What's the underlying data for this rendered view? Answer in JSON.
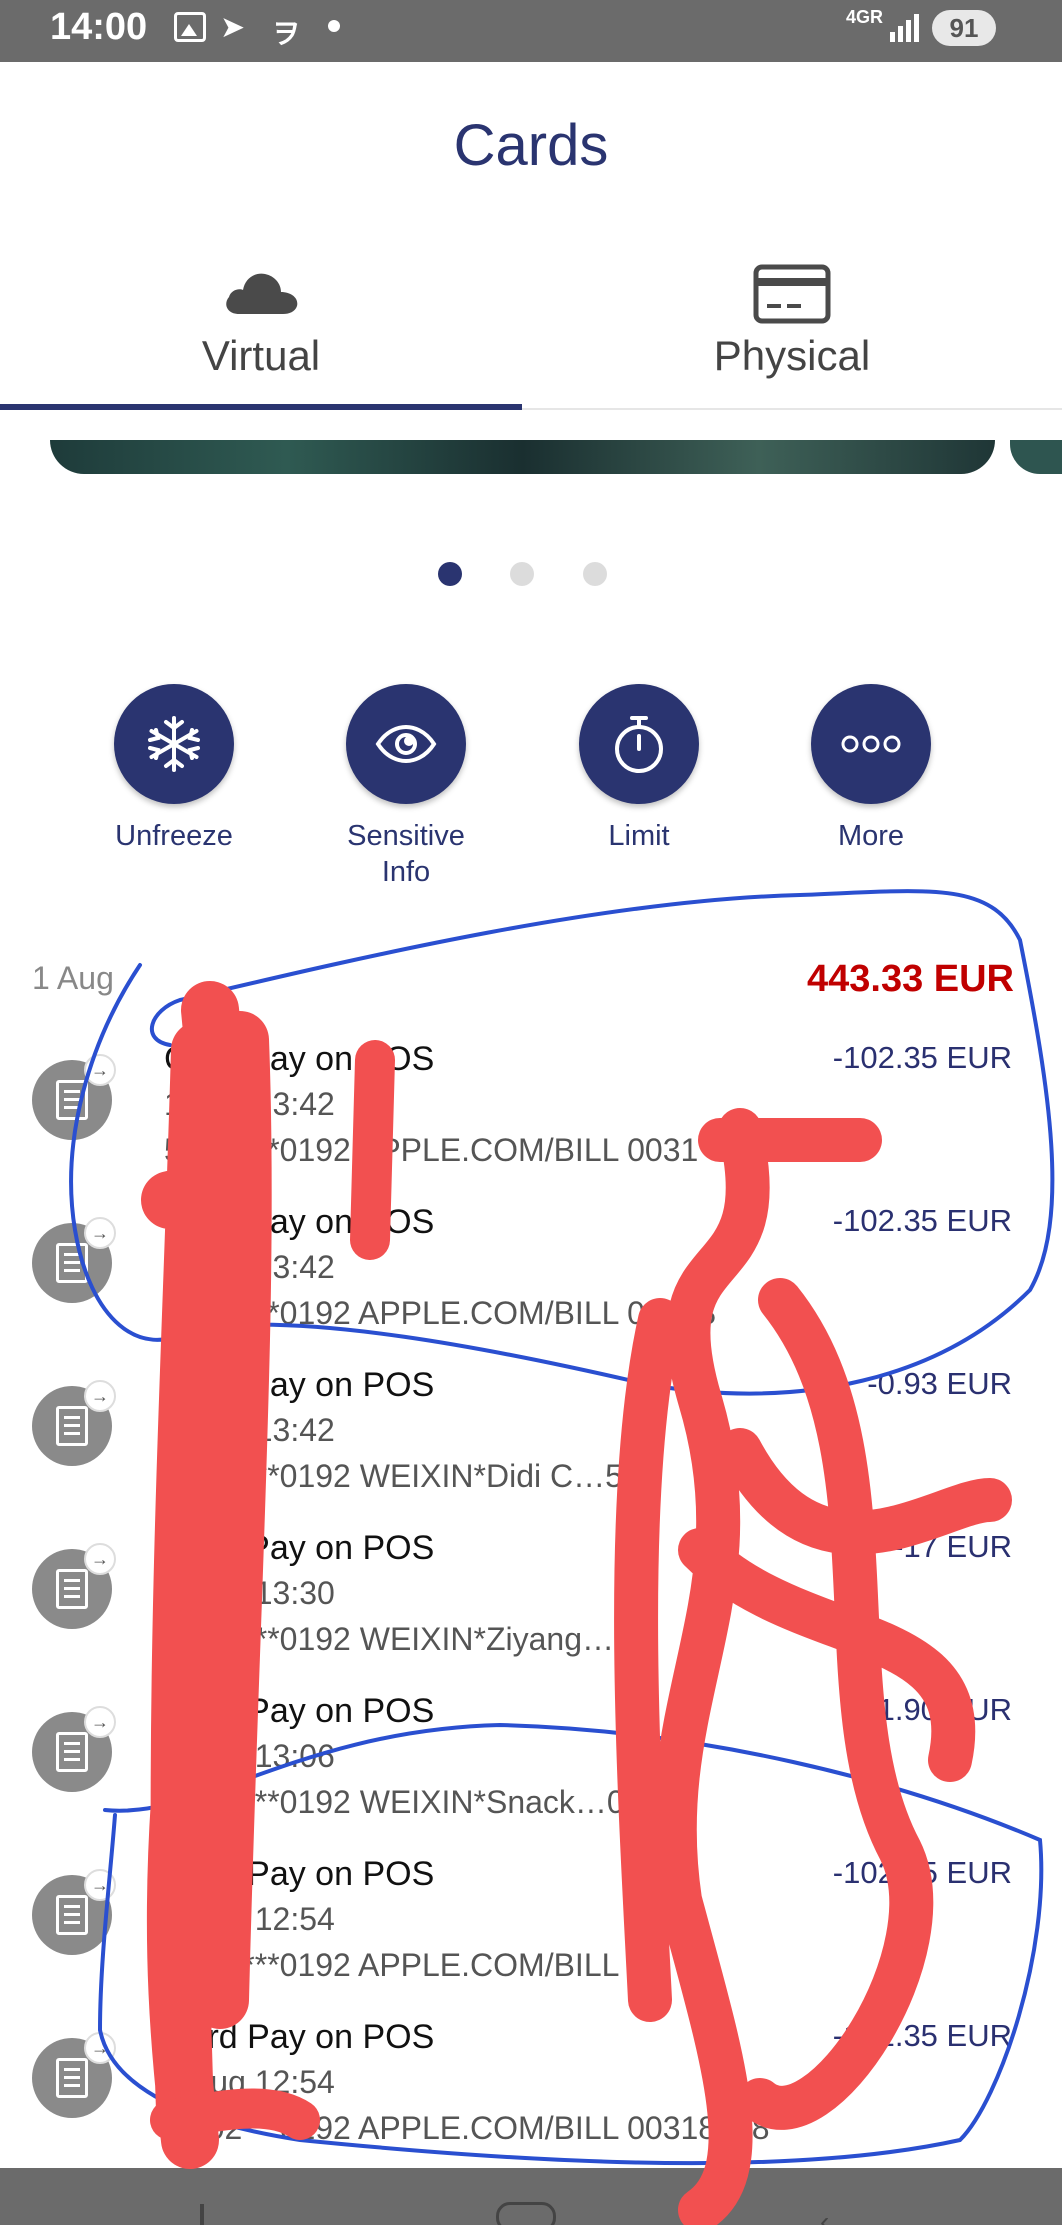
{
  "status_bar": {
    "time": "14:00",
    "network": "4G",
    "roaming": "R",
    "battery": "91"
  },
  "header": {
    "title": "Cards"
  },
  "tabs": [
    {
      "label": "Virtual",
      "icon": "cloud-icon",
      "active": true
    },
    {
      "label": "Physical",
      "icon": "card-icon",
      "active": false
    }
  ],
  "pager": {
    "count": 3,
    "active_index": 0
  },
  "actions": [
    {
      "label": "Unfreeze",
      "icon": "snowflake-icon"
    },
    {
      "label": "Sensitive Info",
      "icon": "eye-icon"
    },
    {
      "label": "Limit",
      "icon": "stopwatch-icon"
    },
    {
      "label": "More",
      "icon": "more-icon"
    }
  ],
  "transactions_group": {
    "date": "1 Aug",
    "total": "443.33 EUR",
    "total_color": "#c00000"
  },
  "transactions": [
    {
      "title": "Card Pay on POS",
      "time": "1 Aug 13:42",
      "description": "5**02***0192 APPLE.COM/BILL 0031",
      "amount": "-102.35 EUR"
    },
    {
      "title": "Card Pay on POS",
      "time": "1 Aug 13:42",
      "description": "5**02***0192 APPLE.COM/BILL 00318",
      "amount": "-102.35 EUR"
    },
    {
      "title": "Card Pay on POS",
      "time": "1 Aug 13:42",
      "description": "5**02***0192 WEIXIN*Didi C…55",
      "amount": "-0.93 EUR"
    },
    {
      "title": "Card Pay on POS",
      "time": "1 Aug 13:30",
      "description": "5**02***0192 WEIXIN*Ziyang…",
      "amount": "-17 EUR"
    },
    {
      "title": "Card Pay on POS",
      "time": "1 Aug 13:06",
      "description": "5**02***0192 WEIXIN*Snack…09518",
      "amount": "-1.90 EUR"
    },
    {
      "title": "Card Pay on POS",
      "time": "1 Aug 12:54",
      "description": "5**02***0192 APPLE.COM/BILL 00",
      "amount": "-102.35 EUR"
    },
    {
      "title": "Card Pay on POS",
      "time": "1 Aug 12:54",
      "description": "5**02***0192 APPLE.COM/BILL 00318458",
      "amount": "-102.35 EUR"
    }
  ],
  "colors": {
    "primary": "#2a3470",
    "annotation_red": "#f25050",
    "annotation_blue": "#2a4fd0"
  }
}
